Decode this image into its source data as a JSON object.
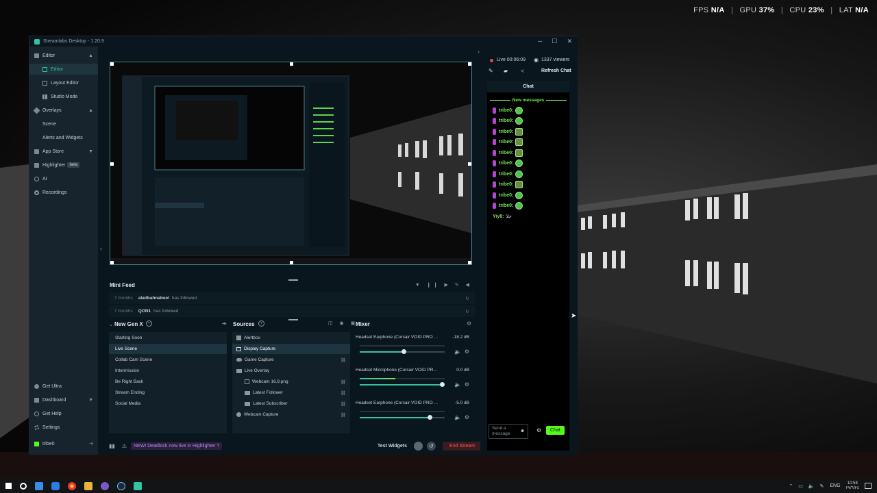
{
  "perf": {
    "fps_label": "FPS",
    "fps": "N/A",
    "gpu_label": "GPU",
    "gpu": "37",
    "cpu_label": "CPU",
    "cpu": "23",
    "lat_label": "LAT",
    "lat": "N/A",
    "pct": "%",
    "sep": "|"
  },
  "window": {
    "title": "Streamlabs Desktop - 1.20.9",
    "min": "─",
    "max": "☐",
    "close": "✕"
  },
  "sidebar": {
    "editor": "Editor",
    "editor_sub": "Editor",
    "layout_editor": "Layout Editor",
    "studio_mode": "Studio Mode",
    "overlays": "Overlays",
    "scene": "Scene",
    "alerts": "Alerts and Widgets",
    "app_store": "App Store",
    "highlighter": "Highlighter",
    "beta": "beta",
    "ai": "AI",
    "recordings": "Recordings",
    "get_ultra": "Get Ultra",
    "dashboard": "Dashboard",
    "get_help": "Get Help",
    "settings": "Settings",
    "user": "tribe0"
  },
  "minifeed": {
    "title": "Mini Feed",
    "rows": [
      {
        "time": "7 months",
        "name": "aladbahnabeel",
        "action": "has followed"
      },
      {
        "time": "7 months",
        "name": "QON1",
        "action": "has followed"
      }
    ]
  },
  "scenes": {
    "title": "New Gen X",
    "items": [
      "Starting Soon",
      "Live Scene",
      "Collab Cam Scene",
      "Intermission",
      "Be Right Back",
      "Stream Ending",
      "Social Media"
    ]
  },
  "sources": {
    "title": "Sources",
    "items": [
      "Alertbox",
      "Display Capture",
      "Game Capture",
      "Live Overlay",
      "Webcam 16.9.png",
      "Latest Follower",
      "Latest Subscriber",
      "Webcam Capture"
    ]
  },
  "mixer": {
    "title": "Mixer",
    "channels": [
      {
        "name": "Headset Earphone (Corsair VOID PRO ...",
        "db": "-18.2 dB",
        "level": 0,
        "volume": 0.52
      },
      {
        "name": "Headset Microphone (Corsair VOID PR...",
        "db": "0.0 dB",
        "level": 0.42,
        "volume": 0.97
      },
      {
        "name": "Headset Earphone (Corsair VOID PRO ...",
        "db": "-5.0 dB",
        "level": 0,
        "volume": 0.82
      }
    ]
  },
  "footer": {
    "news": "NEW! Deadlock now live in Highlighter ?",
    "test_widgets": "Test Widgets",
    "end_stream": "End Stream"
  },
  "chat": {
    "live": "Live 00:06:09",
    "viewers": "1337 viewers",
    "refresh": "Refresh Chat",
    "title": "Chat",
    "new_messages": "New messages",
    "messages": [
      {
        "user": "tribe0:",
        "emote": "round"
      },
      {
        "user": "tribe0:",
        "emote": "round"
      },
      {
        "user": "tribe0:",
        "emote": "square"
      },
      {
        "user": "tribe0:",
        "emote": "square"
      },
      {
        "user": "tribe0:",
        "emote": "square"
      },
      {
        "user": "tribe0:",
        "emote": "round"
      },
      {
        "user": "tribe0:",
        "emote": "round"
      },
      {
        "user": "tribe0:",
        "emote": "square"
      },
      {
        "user": "tribe0:",
        "emote": "round"
      },
      {
        "user": "tribe0:",
        "emote": "round"
      }
    ],
    "last_user": "Yiy8:",
    "last_text": "ﺧﻼ",
    "input_placeholder": "Send a message",
    "send": "Chat"
  },
  "taskbar": {
    "lang": "ENG",
    "time": "10:58",
    "date": "٢٧/٦/٢٤"
  },
  "colors": {
    "accent": "#31c3a2",
    "chat_green": "#7be55b",
    "end_stream": "#e24c4c",
    "news": "#9b5de5"
  }
}
